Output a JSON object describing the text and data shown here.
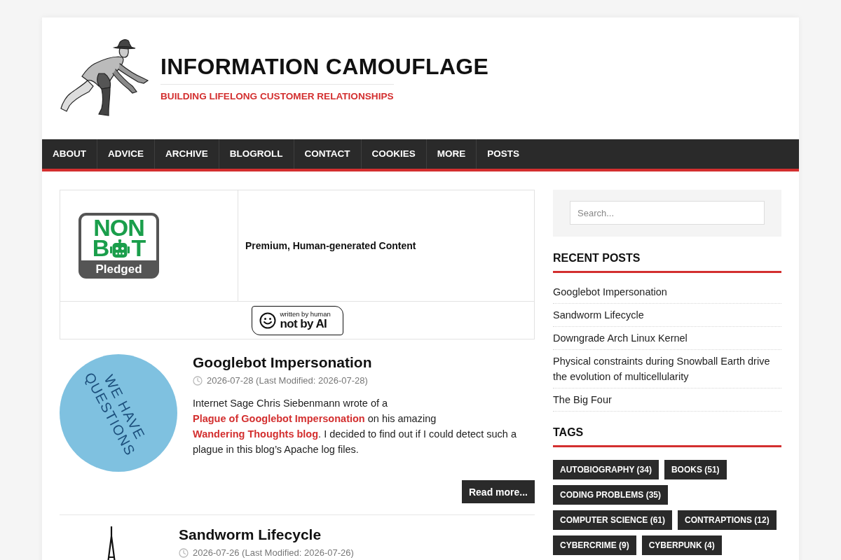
{
  "header": {
    "title": "INFORMATION CAMOUFLAGE",
    "tagline": "BUILDING LIFELONG CUSTOMER RELATIONSHIPS"
  },
  "nav": [
    "ABOUT",
    "ADVICE",
    "ARCHIVE",
    "BLOGROLL",
    "CONTACT",
    "COOKIES",
    "MORE",
    "POSTS"
  ],
  "pledge_table": {
    "nonbot_badge": {
      "top": "NON",
      "left": "B",
      "right": "T",
      "caption": "Pledged"
    },
    "statement": "Premium, Human-generated Content",
    "human_badge": {
      "small": "written by human",
      "large": "not by AI"
    }
  },
  "posts": [
    {
      "title": "Googlebot Impersonation",
      "meta": "2026-07-28 (Last Modified: 2026-07-28)",
      "image": {
        "kind": "sticker",
        "lines": [
          "WE HAVE",
          "QUESTIONS"
        ]
      },
      "excerpt": [
        {
          "kind": "text",
          "text": "Internet Sage Chris Siebenmann wrote of a "
        },
        {
          "kind": "link",
          "text": "Plague of Googlebot Impersonation"
        },
        {
          "kind": "text",
          "text": " on his amazing "
        },
        {
          "kind": "link",
          "text": "Wandering Thoughts blog"
        },
        {
          "kind": "text",
          "text": ". I decided to find out if I could detect such a plague in this blog’s Apache log files."
        }
      ],
      "button": "Read more..."
    },
    {
      "title": "Sandworm Lifecycle",
      "meta": "2026-07-26 (Last Modified: 2026-07-26)",
      "image": {
        "kind": "spire"
      }
    }
  ],
  "sidebar": {
    "search": {
      "placeholder": "Search..."
    },
    "recent_posts": {
      "title": "RECENT POSTS",
      "items": [
        "Googlebot Impersonation",
        "Sandworm Lifecycle",
        "Downgrade Arch Linux Kernel",
        "Physical constraints during Snowball Earth drive the evolution of multicellularity",
        "The Big Four"
      ]
    },
    "tags": {
      "title": "TAGS",
      "items": [
        "AUTOBIOGRAPHY (34)",
        "BOOKS (51)",
        "CODING PROBLEMS (35)",
        "COMPUTER SCIENCE (61)",
        "CONTRAPTIONS (12)",
        "CYBERCRIME (9)",
        "CYBERPUNK (4)"
      ]
    }
  }
}
